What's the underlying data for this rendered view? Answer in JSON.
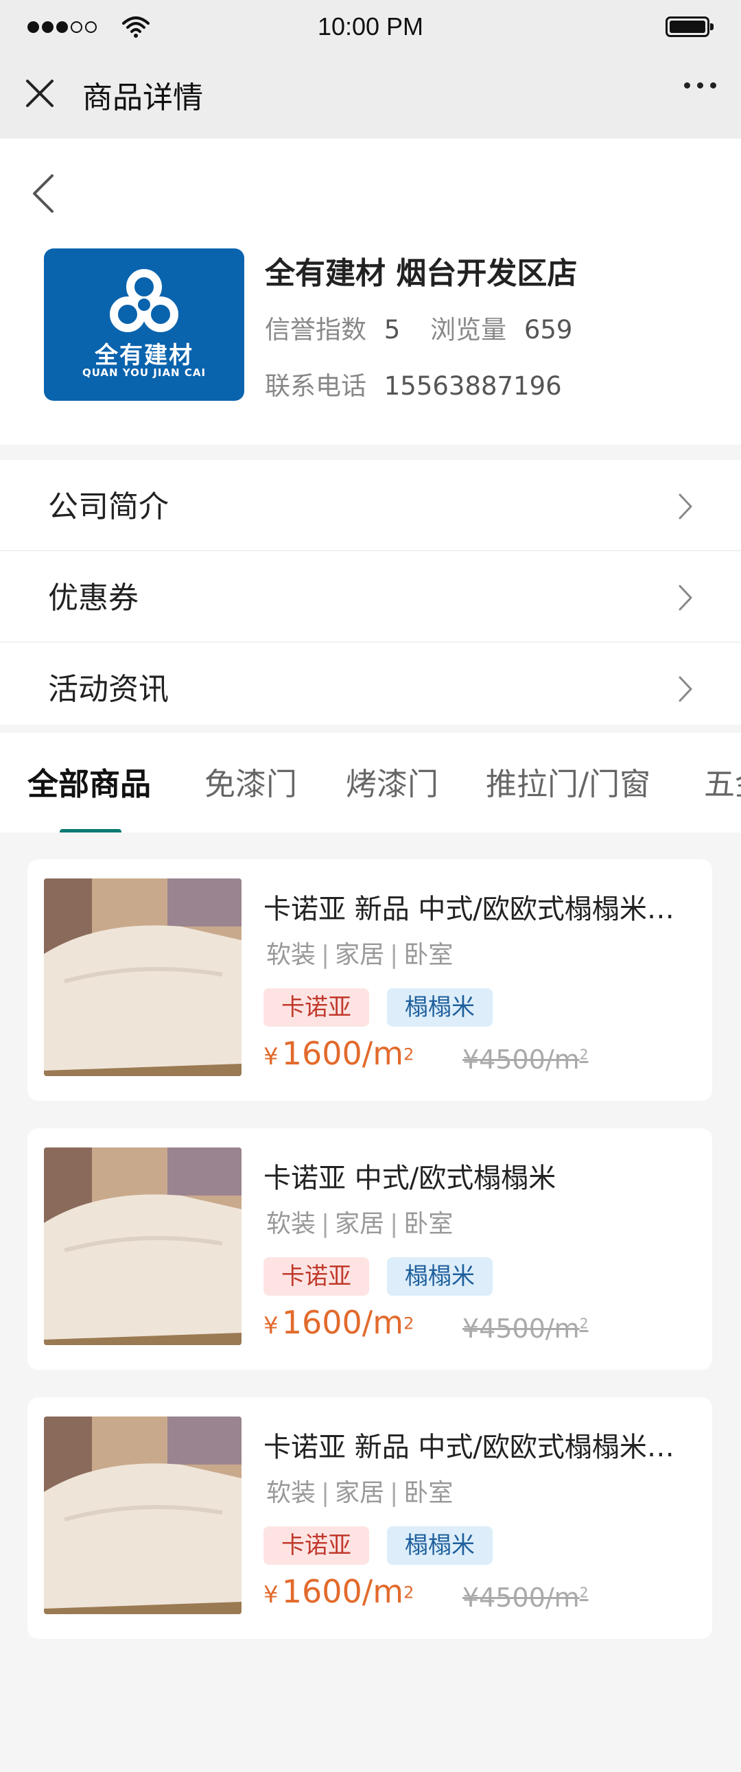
{
  "status_bar": {
    "time": "10:00 PM"
  },
  "nav": {
    "title": "商品详情"
  },
  "shop": {
    "name": "全有建材  烟台开发区店",
    "logo_cn": "全有建材",
    "logo_en": "QUAN YOU JIAN CAI",
    "credit_label": "信誉指数",
    "credit_value": "5",
    "views_label": "浏览量",
    "views_value": "659",
    "phone_label": "联系电话",
    "phone_value": "15563887196",
    "brand_color": "#0a63ad"
  },
  "menu": {
    "items": [
      {
        "label": "公司简介"
      },
      {
        "label": "优惠券"
      },
      {
        "label": "活动资讯"
      }
    ]
  },
  "tabs": {
    "items": [
      {
        "label": "全部商品",
        "active": true
      },
      {
        "label": "免漆门"
      },
      {
        "label": "烤漆门"
      },
      {
        "label": "推拉门/门窗"
      },
      {
        "label": "五金"
      }
    ],
    "accent_color": "#0b7a72"
  },
  "products": [
    {
      "name": "卡诺亚 新品 中式/欧欧式榻榻米…",
      "cat1": "软装",
      "cat2": "家居",
      "cat3": "卧室",
      "tag_brand": "卡诺亚",
      "tag_type": "榻榻米",
      "currency": "¥",
      "price": "1600/m",
      "price_sup": "2",
      "old_price": "¥4500/m",
      "old_sup": "2"
    },
    {
      "name": "卡诺亚  中式/欧式榻榻米",
      "cat1": "软装",
      "cat2": "家居",
      "cat3": "卧室",
      "tag_brand": "卡诺亚",
      "tag_type": "榻榻米",
      "currency": "¥",
      "price": "1600/m",
      "price_sup": "2",
      "old_price": "¥4500/m",
      "old_sup": "2"
    },
    {
      "name": "卡诺亚 新品 中式/欧欧式榻榻米…",
      "cat1": "软装",
      "cat2": "家居",
      "cat3": "卧室",
      "tag_brand": "卡诺亚",
      "tag_type": "榻榻米",
      "currency": "¥",
      "price": "1600/m",
      "price_sup": "2",
      "old_price": "¥4500/m",
      "old_sup": "2"
    }
  ],
  "colors": {
    "price": "#e26a2c",
    "tag_brand_bg": "#fde4e3",
    "tag_type_bg": "#ddeefa"
  }
}
